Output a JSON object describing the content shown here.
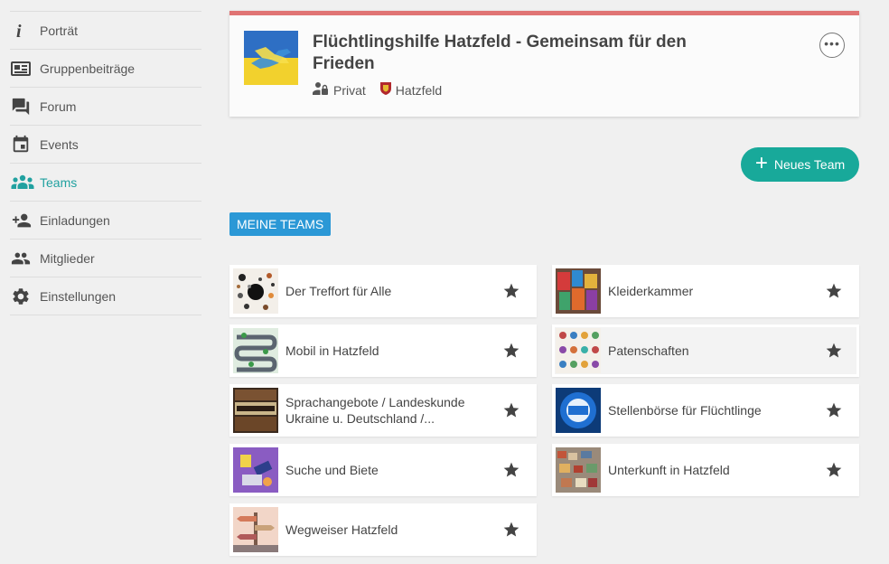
{
  "sidebar": {
    "items": [
      {
        "label": "Porträt",
        "icon": "info-icon"
      },
      {
        "label": "Gruppenbeiträge",
        "icon": "newspaper-icon"
      },
      {
        "label": "Forum",
        "icon": "forum-icon"
      },
      {
        "label": "Events",
        "icon": "calendar-icon"
      },
      {
        "label": "Teams",
        "icon": "teams-icon",
        "active": true
      },
      {
        "label": "Einladungen",
        "icon": "add-person-icon"
      },
      {
        "label": "Mitglieder",
        "icon": "members-icon"
      },
      {
        "label": "Einstellungen",
        "icon": "gear-icon"
      }
    ],
    "active_color": "#21a1a0"
  },
  "group": {
    "title": "Flüchtlingshilfe Hatzfeld - Gemeinsam für den Frieden",
    "privacy": "Privat",
    "location": "Hatzfeld",
    "more_label": "•••",
    "accent_color": "#e07474"
  },
  "actions": {
    "new_team_label": "Neues Team",
    "new_team_color": "#18a99a"
  },
  "section": {
    "label": "MEINE TEAMS",
    "color": "#2b98d6"
  },
  "teams": [
    {
      "name": "Der Treffort für Alle",
      "thumb": "treffort"
    },
    {
      "name": "Kleiderkammer",
      "thumb": "kleider"
    },
    {
      "name": "Mobil in Hatzfeld",
      "thumb": "mobil"
    },
    {
      "name": "Patenschaften",
      "thumb": "paten"
    },
    {
      "name": "Sprachangebote / Landeskunde Ukraine u. Deutschland /...",
      "thumb": "sprache"
    },
    {
      "name": "Stellenbörse für Flüchtlinge",
      "thumb": "jobs"
    },
    {
      "name": "Suche und Biete",
      "thumb": "suche"
    },
    {
      "name": "Unterkunft in Hatzfeld",
      "thumb": "unterkunft"
    },
    {
      "name": "Wegweiser Hatzfeld",
      "thumb": "wegweiser"
    }
  ]
}
